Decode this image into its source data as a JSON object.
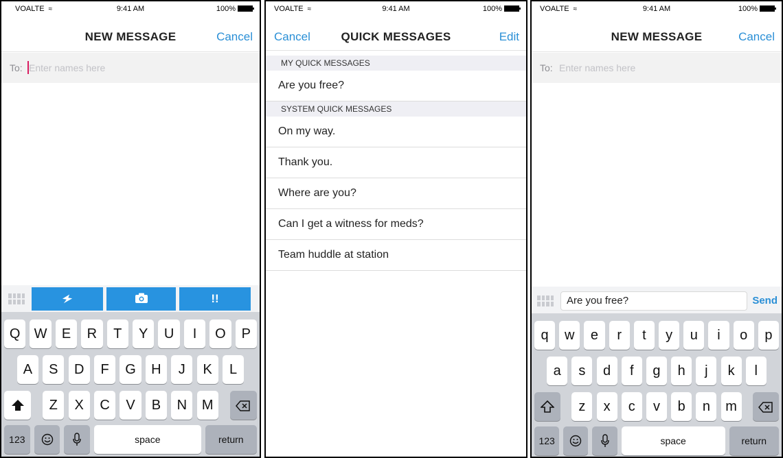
{
  "status": {
    "carrier": "VOALTE",
    "wifi_icon": "wifi-icon",
    "time": "9:41 AM",
    "battery": "100%"
  },
  "panel1": {
    "title": "NEW MESSAGE",
    "cancel": "Cancel",
    "to_label": "To:",
    "to_placeholder": "Enter names here",
    "toolbar": {
      "grid_icon": "grid-icon",
      "quick_icon": "lightning-icon",
      "camera_icon": "camera-icon",
      "urgent_label": "!!"
    }
  },
  "panel2": {
    "cancel": "Cancel",
    "title": "QUICK MESSAGES",
    "edit": "Edit",
    "section_mine": "MY QUICK MESSAGES",
    "my_messages": [
      "Are you free?"
    ],
    "section_system": "SYSTEM QUICK MESSAGES",
    "system_messages": [
      "On my way.",
      "Thank you.",
      "Where are you?",
      "Can I get a witness for meds?",
      "Team huddle at station"
    ]
  },
  "panel3": {
    "title": "NEW MESSAGE",
    "cancel": "Cancel",
    "to_label": "To:",
    "to_placeholder": "Enter names here",
    "message_value": "Are you free?",
    "send": "Send"
  },
  "keyboard_upper": {
    "row1": [
      "Q",
      "W",
      "E",
      "R",
      "T",
      "Y",
      "U",
      "I",
      "O",
      "P"
    ],
    "row2": [
      "A",
      "S",
      "D",
      "F",
      "G",
      "H",
      "J",
      "K",
      "L"
    ],
    "row3": [
      "Z",
      "X",
      "C",
      "V",
      "B",
      "N",
      "M"
    ],
    "numbers": "123",
    "space": "space",
    "return": "return"
  },
  "keyboard_lower": {
    "row1": [
      "q",
      "w",
      "e",
      "r",
      "t",
      "y",
      "u",
      "i",
      "o",
      "p"
    ],
    "row2": [
      "a",
      "s",
      "d",
      "f",
      "g",
      "h",
      "j",
      "k",
      "l"
    ],
    "row3": [
      "z",
      "x",
      "c",
      "v",
      "b",
      "n",
      "m"
    ],
    "numbers": "123",
    "space": "space",
    "return": "return"
  },
  "colors": {
    "accent": "#2a8fd6",
    "toolbar_button": "#2893e0",
    "cursor": "#d81b60",
    "keyboard_bg": "#d1d4d9"
  }
}
